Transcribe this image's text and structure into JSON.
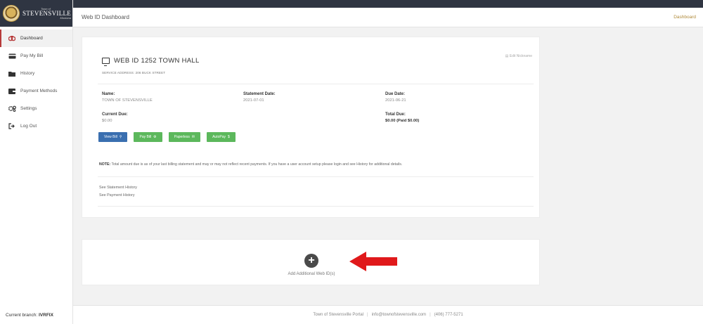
{
  "sidebar": {
    "logo": {
      "small": "Town of",
      "big": "STEVENSVILLE",
      "sub": "Montana"
    },
    "items": [
      {
        "label": "Dashboard",
        "icon": "dashboard-icon",
        "active": true
      },
      {
        "label": "Pay My Bill",
        "icon": "credit-card-icon",
        "active": false
      },
      {
        "label": "History",
        "icon": "folder-icon",
        "active": false
      },
      {
        "label": "Payment Methods",
        "icon": "wallet-icon",
        "active": false
      },
      {
        "label": "Settings",
        "icon": "gear-icon",
        "active": false
      },
      {
        "label": "Log Out",
        "icon": "logout-icon",
        "active": false
      }
    ],
    "branch_label": "Current branch:",
    "branch_value": "IVRFIX"
  },
  "header": {
    "title": "Web ID Dashboard",
    "breadcrumb": "Dashboard"
  },
  "card": {
    "web_id_title": "WEB ID 1252 TOWN HALL",
    "service_address": "SERVICE ADDRESS: 206 BUCK STREET",
    "edit_nickname": "Edit Nickname",
    "name_label": "Name:",
    "name_value": "TOWN OF STEVENSVILLE",
    "statement_label": "Statement Date:",
    "statement_value": "2021-07-01",
    "due_label": "Due Date:",
    "due_value": "2021-06-21",
    "current_due_label": "Current Due:",
    "current_due_value": "$0.00",
    "total_due_label": "Total Due:",
    "total_due_value": "$0.00 (Paid $0.00)",
    "buttons": {
      "view_bill": "View Bill",
      "pay_bill": "Pay Bill",
      "paperless": "Paperless",
      "autopay": "AutoPay"
    },
    "note_label": "NOTE:",
    "note_text": "Total amount due is as of your last billing statement and may or may not reflect recent payments. If you have a user account setup please login and see History for additional details.",
    "statement_history": "See Statement History",
    "payment_history": "See Payment History"
  },
  "add": {
    "plus": "+",
    "label": "Add Additional Web ID(s)"
  },
  "footer": {
    "portal": "Town of Stevensville Portal",
    "email": "info@townofstevensville.com",
    "phone": "(406) 777-5271"
  },
  "colors": {
    "accent": "#b73a3a",
    "primary_button": "#3a6fb0",
    "success_button": "#5cb85c",
    "arrow": "#e0191b",
    "topbar": "#2f3542"
  }
}
